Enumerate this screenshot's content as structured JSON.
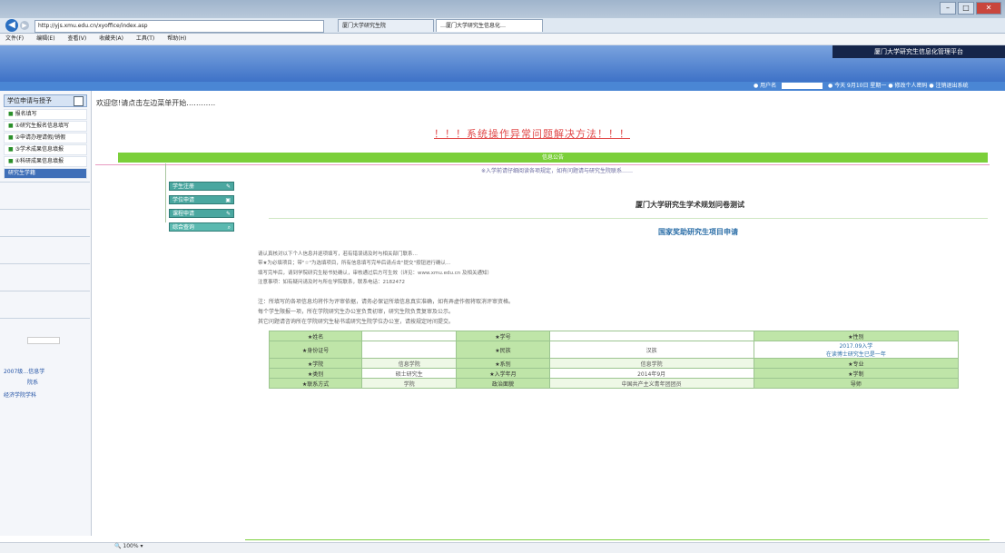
{
  "browser": {
    "url": "http://yjs.xmu.edu.cn/xyoffice/index.asp",
    "tabs": [
      "厦门大学研究生院",
      "…厦门大学研究生信息化…"
    ],
    "menu": [
      "文件(F)",
      "编辑(E)",
      "查看(V)",
      "收藏夹(A)",
      "工具(T)",
      "帮助(H)"
    ],
    "zoom": "100%"
  },
  "header": {
    "platform_title": "厦门大学研究生信息化管理平台",
    "login_strip_label": "● 用户名",
    "login_strip_items": "● 今天 9月10日 星期一  ● 修改个人密码  ● 注销退出系统"
  },
  "sidebar": {
    "title": "学位申请与授予",
    "items": [
      "报名填写",
      "①研究生报名信息填写",
      "②申请办理请假/销假",
      "③学术成果信息填报",
      "④科研成果信息填报"
    ],
    "selected_item": "研究生学籍",
    "links": [
      "2007级…信息学",
      "院系",
      "经济学院学科"
    ]
  },
  "main": {
    "greeting": "欢迎您!请点击左边菜单开始…………",
    "headline": "！！！系统操作异常问题解决方法！！！",
    "bar_title": "信息公告",
    "marquee": "※入学前请仔细阅读各项规定，如有问题请与研究生院联系……",
    "mini_menu": [
      "学生注册",
      "学位申请",
      "课程申请",
      "综合查询"
    ],
    "university_title": "厦门大学研究生学术规划问卷测试",
    "apply_title": "国家奖助研究生项目申请",
    "notes": [
      "请认真核对以下个人信息并逐项填写，若有错误请及时与相关部门联系…",
      "带★为必填项目；带\"☆\"为选填项目，所有信息填写完毕后请点击\"提交\"按钮进行确认…",
      "填写完毕后，请到学院研究生秘书处确认，审核通过后方可生效（详见：www.xmu.edu.cn 及相关通知）",
      "注意事项：如有疑问请及时与所在学院联系，联系电话：2182472"
    ],
    "warnings": [
      "注：所填写的各项信息均将作为评审依据，请务必保证所填信息真实准确，如有弄虚作假将取消评审资格。",
      "每个学生限报一项，所在学院研究生办公室负责初审，研究生院负责复审及公示。",
      "其它问题请咨询所在学院研究生秘书或研究生院学位办公室，请按规定时间提交。"
    ],
    "form": {
      "rows": [
        [
          "★姓名",
          "",
          "★学号",
          "",
          "★性别"
        ],
        [
          "★身份证号",
          "",
          "★民族",
          "汉族",
          "2017.09入学\n在读博士研究生已是一年"
        ],
        [
          "★学院",
          "信息学院",
          "★系别",
          "信息学院",
          "★专业"
        ],
        [
          "★类别",
          "硕士研究生",
          "★入学年月",
          "2014年9月",
          "★学制"
        ],
        [
          "★联系方式",
          "学院",
          "政治面貌",
          "中国共产主义青年团团员",
          "导师"
        ]
      ]
    }
  }
}
